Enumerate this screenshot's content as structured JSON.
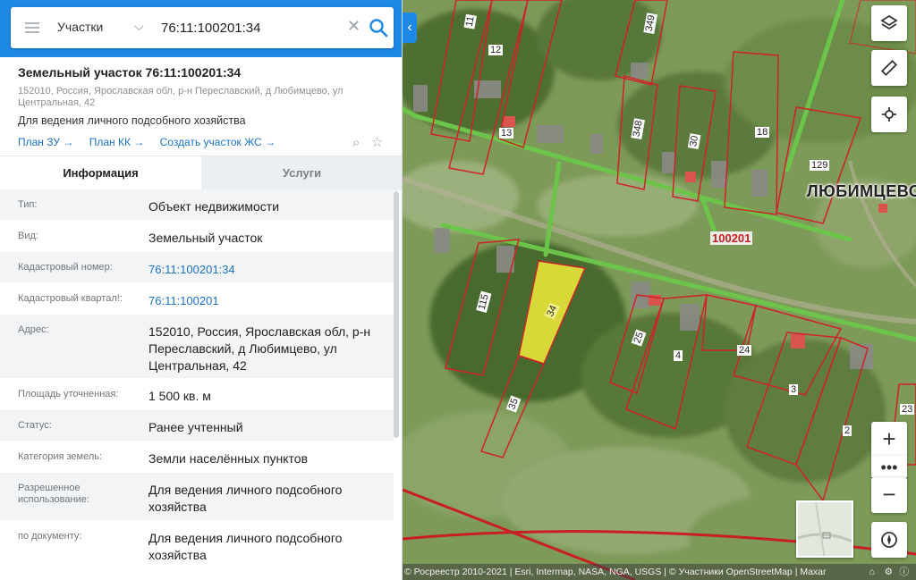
{
  "search": {
    "category": "Участки",
    "query": "76:11:100201:34"
  },
  "object": {
    "title": "Земельный участок 76:11:100201:34",
    "address": "152010, Россия, Ярославская обл, р-н Переславский, д Любимцево, ул Центральная, 42",
    "purpose": "Для ведения личного подсобного хозяйства",
    "links": [
      "План ЗУ →",
      "План КК →",
      "Создать участок ЖС →"
    ]
  },
  "tabs": {
    "info": "Информация",
    "services": "Услуги"
  },
  "rows": [
    {
      "label": "Тип:",
      "value": "Объект недвижимости",
      "link": false
    },
    {
      "label": "Вид:",
      "value": "Земельный участок",
      "link": false
    },
    {
      "label": "Кадастровый номер:",
      "value": "76:11:100201:34",
      "link": true
    },
    {
      "label": "Кадастровый квартал!:",
      "value": "76:11:100201",
      "link": true
    },
    {
      "label": "Адрес:",
      "value": "152010, Россия, Ярославская обл, р-н Переславский, д Любимцево, ул Центральная, 42",
      "link": false
    },
    {
      "label": "Площадь уточненная:",
      "value": "1 500 кв. м",
      "link": false
    },
    {
      "label": "Статус:",
      "value": "Ранее учтенный",
      "link": false
    },
    {
      "label": "Категория земель:",
      "value": "Земли населённых пунктов",
      "link": false
    },
    {
      "label": "Разрешенное использование:",
      "value": "Для ведения личного подсобного хозяйства",
      "link": false
    },
    {
      "label": "по документу:",
      "value": "Для ведения личного подсобного хозяйства",
      "link": false
    }
  ],
  "map": {
    "village": "ЛЮБИМЦЕВО",
    "quarter": "100201",
    "selected_parcel": "34",
    "parcel_labels": [
      "11",
      "12",
      "13",
      "349",
      "348",
      "30",
      "18",
      "129",
      "115",
      "35",
      "25",
      "4",
      "24",
      "3",
      "2",
      "23"
    ],
    "attribution": "© Росреестр 2010-2021 | Esri, Intermap, NASA, NGA, USGS | © Участники OpenStreetMap | Maxar",
    "colors": {
      "parcel_border": "#d0212a",
      "selected_fill": "#e6e23a",
      "road": "#6cc54a",
      "label_bg": "#ffffff"
    }
  },
  "icons": {
    "menu": "hamburger-icon",
    "chevron": "chevron-down-icon",
    "clear": "close-icon",
    "search": "search-icon",
    "layers": "layers-icon",
    "ruler": "ruler-icon",
    "locate": "crosshair-icon",
    "zoom_in": "plus-icon",
    "zoom_out": "minus-icon",
    "more": "more-dots-icon",
    "compass": "compass-icon"
  }
}
